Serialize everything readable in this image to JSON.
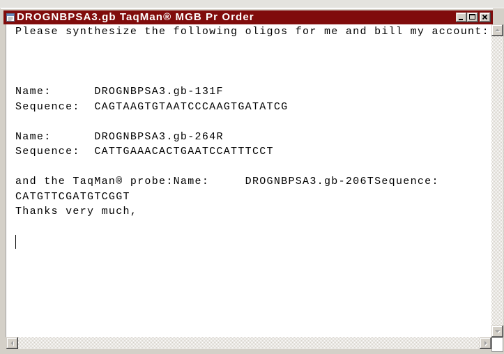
{
  "window": {
    "title": "DROGNBPSA3.gb TaqMan® MGB Pr Order",
    "app_icon": "document-icon",
    "title_bar_color": "#800c0c",
    "title_text_color": "#ffffff",
    "controls": {
      "minimize_icon": "minimize-icon",
      "maximize_icon": "maximize-icon",
      "close_icon": "close-icon"
    }
  },
  "editor": {
    "background": "#ffffff",
    "text_color": "#000000",
    "lines": [
      "Please synthesize the following oligos for me and bill my account:",
      "",
      "",
      "",
      "Name:      DROGNBPSA3.gb-131F",
      "Sequence:  CAGTAAGTGTAATCCCAAGTGATATCG",
      "",
      "Name:      DROGNBPSA3.gb-264R",
      "Sequence:  CATTGAAACACTGAATCCATTTCCT",
      "",
      "and the TaqMan® probe:Name:     DROGNBPSA3.gb-206TSequence:",
      "CATGTTCGATGTCGGT",
      "Thanks very much,",
      "",
      ""
    ]
  },
  "scrollbars": {
    "vertical": {
      "enabled": false,
      "up_icon": "arrow-up-icon",
      "down_icon": "arrow-down-icon"
    },
    "horizontal": {
      "enabled": false,
      "left_icon": "arrow-left-icon",
      "right_icon": "arrow-right-icon"
    }
  }
}
